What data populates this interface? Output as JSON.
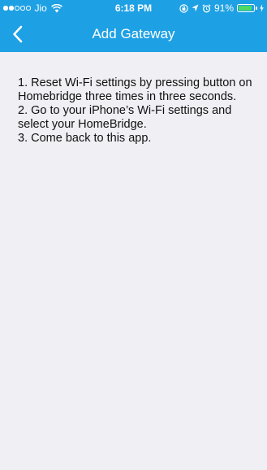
{
  "status_bar": {
    "carrier": "Jio",
    "time": "6:18 PM",
    "battery_percent": "91%",
    "battery_level": 0.91,
    "icons": [
      "signal-dots",
      "wifi-icon",
      "screen-lock-icon",
      "location-arrow-icon",
      "alarm-icon",
      "battery-icon",
      "charging-icon"
    ]
  },
  "nav": {
    "title": "Add Gateway",
    "back_icon": "chevron-left-icon"
  },
  "colors": {
    "header": "#1ea0e4",
    "background": "#efeff4",
    "text": "#111111",
    "battery": "#4cd964"
  },
  "instructions": {
    "steps": [
      "1. Reset Wi-Fi settings by pressing button on Homebridge three times in three seconds.",
      "2. Go to your iPhone’s Wi-Fi settings and select your HomeBridge.",
      "3. Come back to this app."
    ]
  }
}
